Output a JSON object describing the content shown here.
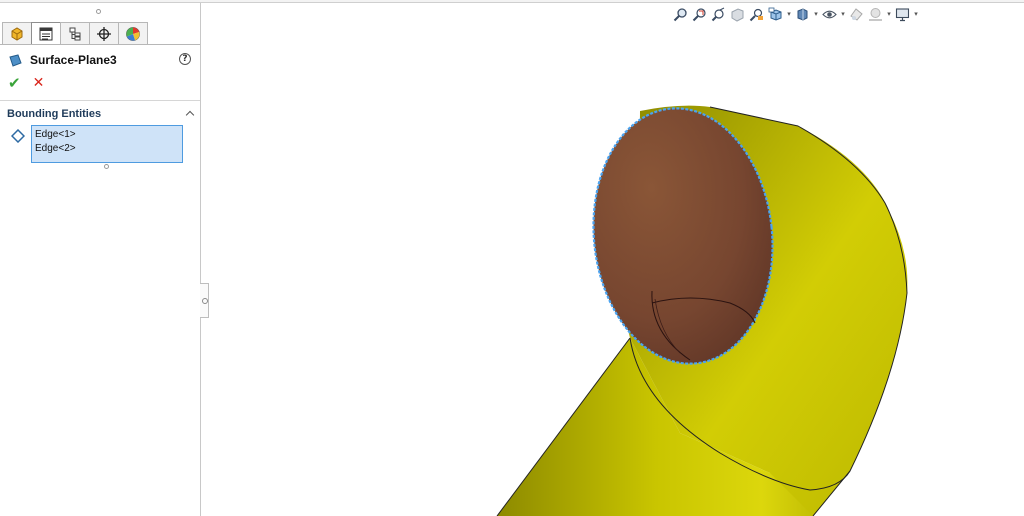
{
  "feature": {
    "title": "Surface-Plane3",
    "help_symbol": "?"
  },
  "tabs": [
    {
      "name": "featuremanager-icon"
    },
    {
      "name": "propertymanager-icon"
    },
    {
      "name": "configurationmanager-icon"
    },
    {
      "name": "dimxpertmanager-icon"
    },
    {
      "name": "displaymanager-icon"
    }
  ],
  "actions": {
    "ok_symbol": "✔",
    "cancel_symbol": "✕"
  },
  "bounding_entities": {
    "title": "Bounding Entities",
    "items": [
      "Edge<1>",
      "Edge<2>"
    ]
  },
  "heads_up_toolbar": [
    "zoom-to-fit-icon",
    "zoom-to-area-icon",
    "previous-view-icon",
    "section-view-icon",
    "dynamic-annotation-icon",
    "view-orientation-icon",
    "display-style-icon",
    "hide-show-items-icon",
    "edit-appearance-icon",
    "apply-scene-icon",
    "view-settings-icon"
  ],
  "colors": {
    "body_yellow": "#c8c400",
    "body_dark": "#8a8700",
    "planar_face": "#7a4a34",
    "selection_edge": "#4aa3f0",
    "selection_fill": "#cfe3f8"
  }
}
